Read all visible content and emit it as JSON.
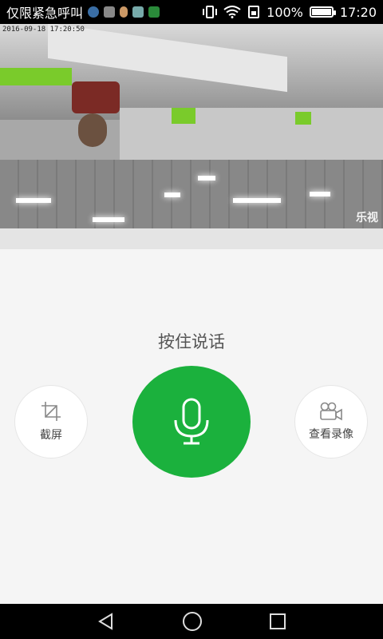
{
  "status_bar": {
    "carrier": "仅限紧急呼叫",
    "battery": "100%",
    "time": "17:20",
    "notification_icons": [
      "message-icon",
      "bag-icon",
      "app-icon",
      "trash-icon",
      "green-app-icon"
    ]
  },
  "video": {
    "timestamp": "2016-09-18 17:20:50",
    "watermark": "乐视"
  },
  "controls": {
    "hint": "按住说话",
    "screenshot_label": "截屏",
    "recording_label": "查看录像"
  },
  "colors": {
    "accent": "#1bb13d"
  }
}
